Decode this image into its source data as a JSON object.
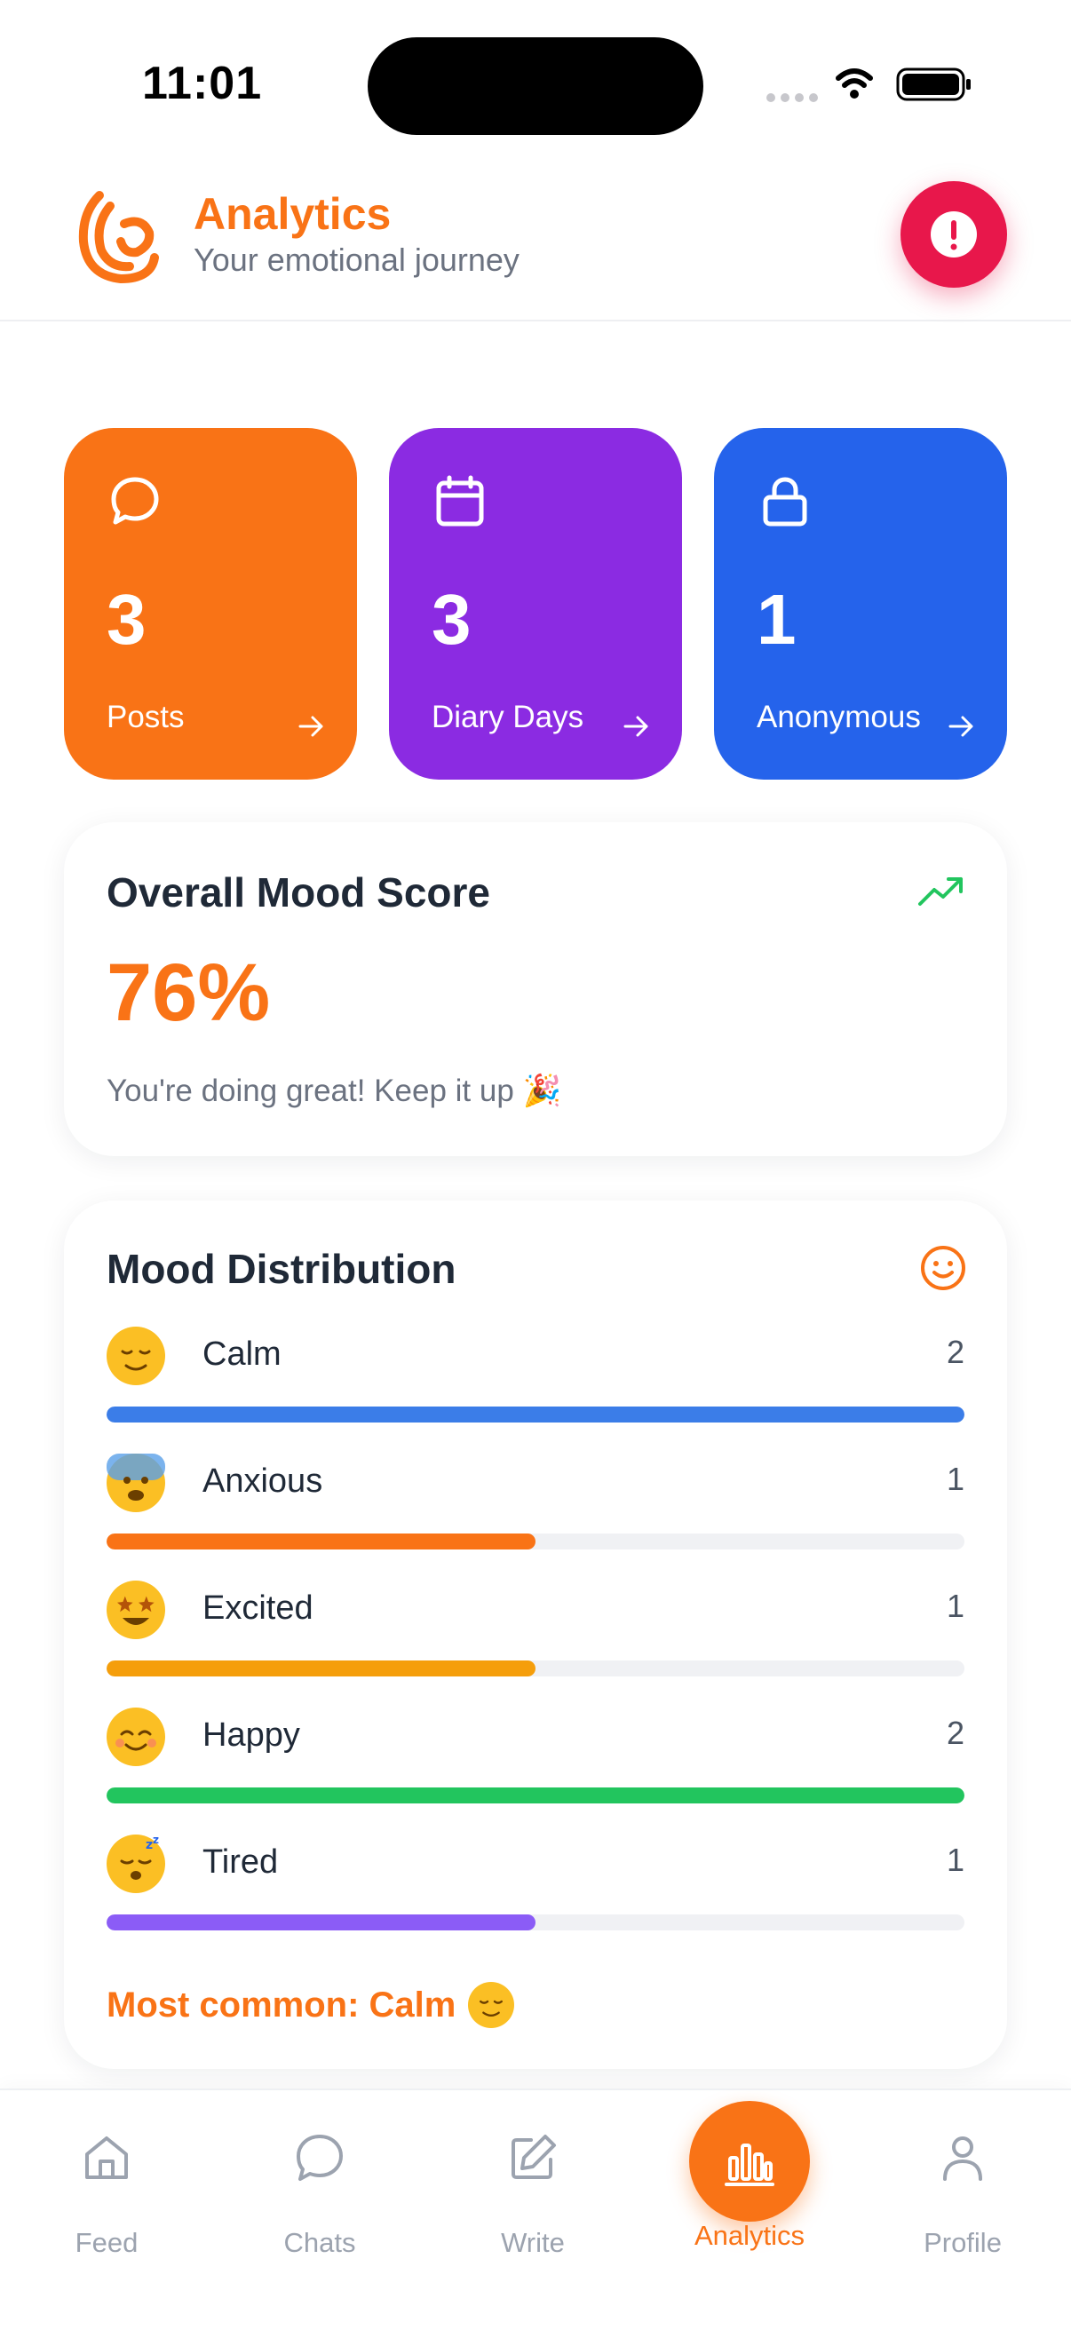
{
  "status_bar": {
    "time": "11:01"
  },
  "header": {
    "title": "Analytics",
    "subtitle": "Your emotional journey",
    "logo_icon": "hand-wave-logo",
    "alert_icon": "exclamation-icon"
  },
  "stats": [
    {
      "value": "3",
      "label": "Posts",
      "icon": "chat-bubble-icon",
      "color": "#f97316"
    },
    {
      "value": "3",
      "label": "Diary Days",
      "icon": "calendar-icon",
      "color": "#8b2be2"
    },
    {
      "value": "1",
      "label": "Anonymous",
      "icon": "lock-icon",
      "color": "#2563eb"
    }
  ],
  "mood_score": {
    "title": "Overall Mood Score",
    "value": "76%",
    "message": "You're doing great! Keep it up 🎉",
    "icon": "trending-up-icon"
  },
  "distribution": {
    "title": "Mood Distribution",
    "icon": "smile-icon",
    "max": 2,
    "items": [
      {
        "label": "Calm",
        "count": 2,
        "emoji": "😌",
        "color": "#3b7de8"
      },
      {
        "label": "Anxious",
        "count": 1,
        "emoji": "😰",
        "color": "#f97316"
      },
      {
        "label": "Excited",
        "count": 1,
        "emoji": "🤩",
        "color": "#f59e0b"
      },
      {
        "label": "Happy",
        "count": 2,
        "emoji": "😊",
        "color": "#22c55e"
      },
      {
        "label": "Tired",
        "count": 1,
        "emoji": "😴",
        "color": "#8b5cf6"
      }
    ],
    "most_common": "Most common: Calm",
    "most_common_emoji": "😌"
  },
  "nav": {
    "items": [
      {
        "label": "Feed",
        "icon": "home-icon"
      },
      {
        "label": "Chats",
        "icon": "chat-icon"
      },
      {
        "label": "Write",
        "icon": "edit-icon"
      },
      {
        "label": "Analytics",
        "icon": "bar-chart-icon",
        "active": true
      },
      {
        "label": "Profile",
        "icon": "user-icon"
      }
    ]
  },
  "colors": {
    "accent": "#f97316",
    "alert": "#e8174b",
    "muted": "#9ca3af"
  }
}
